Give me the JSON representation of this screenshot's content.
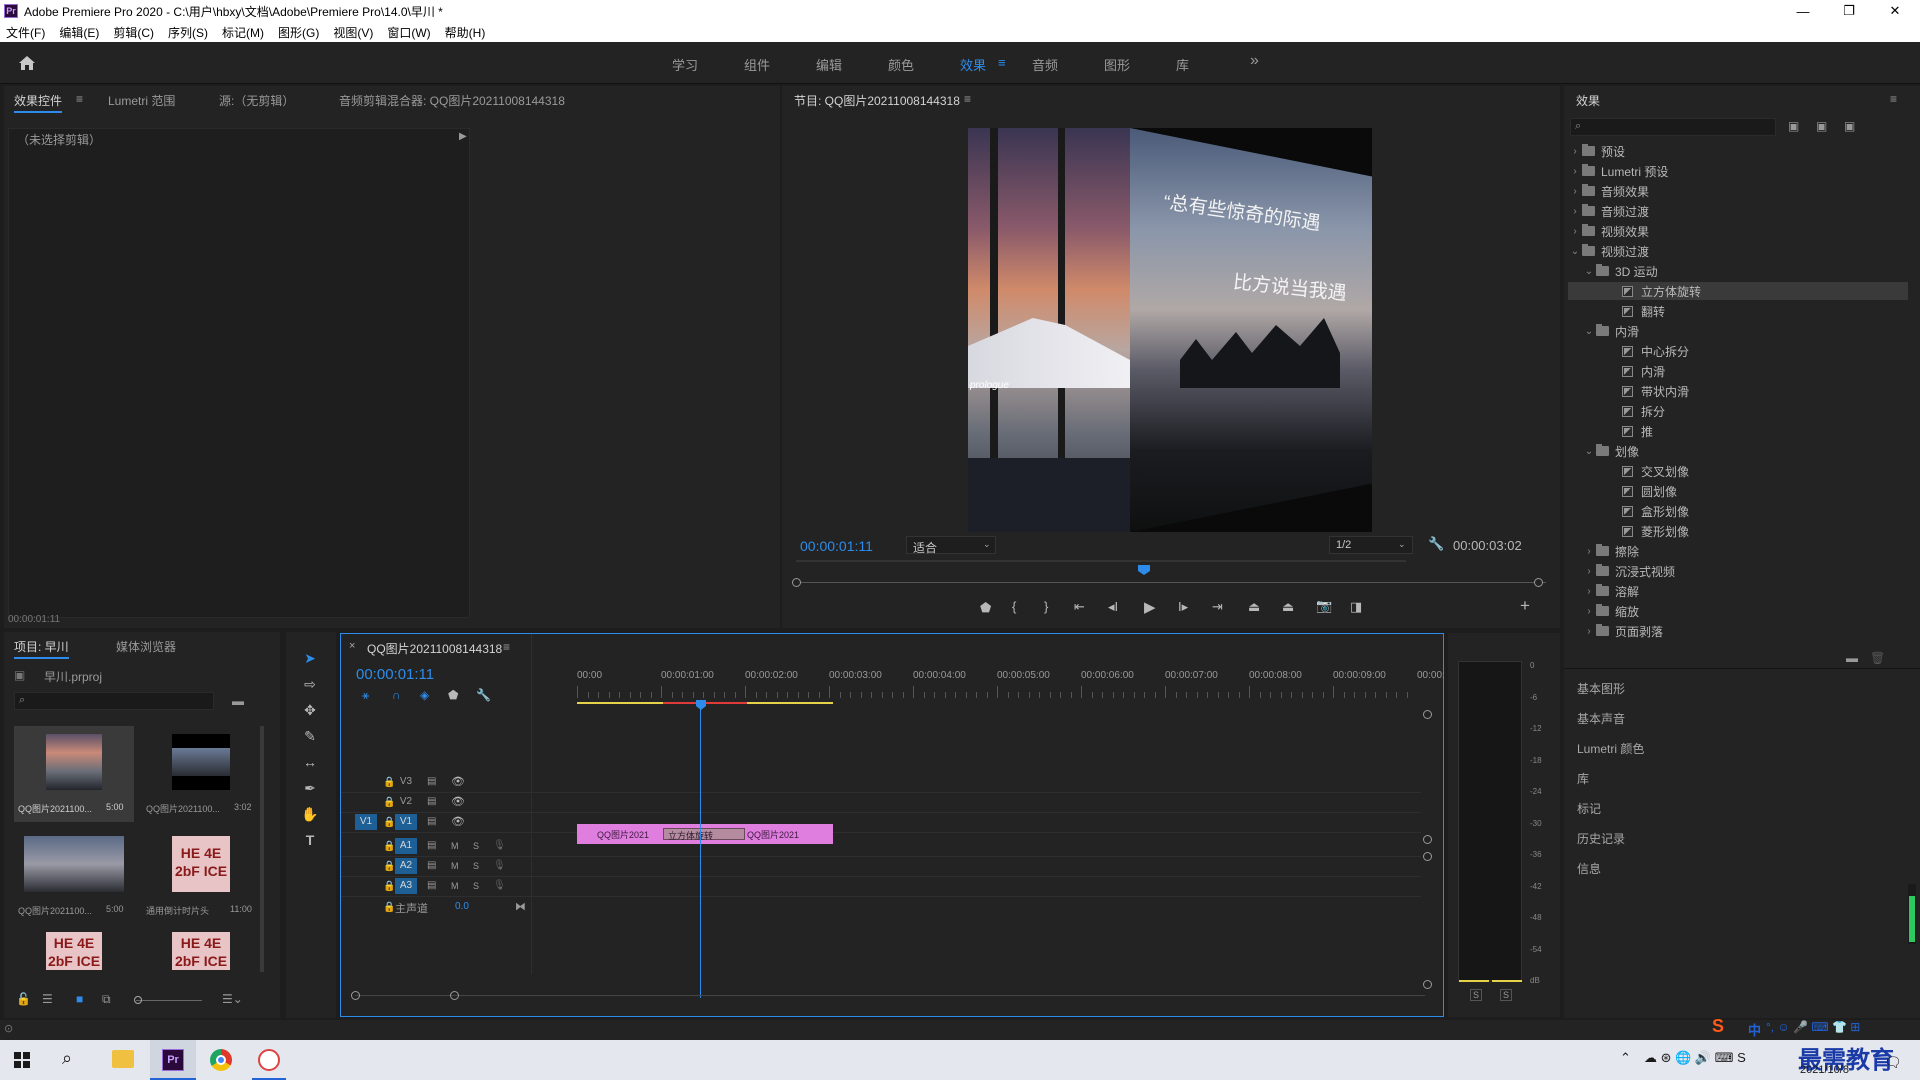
{
  "window": {
    "title": "Adobe Premiere Pro 2020 - C:\\用户\\hbxy\\文档\\Adobe\\Premiere Pro\\14.0\\早川 *",
    "controls": {
      "minimize": "—",
      "maximize": "❐",
      "close": "✕"
    }
  },
  "menu": [
    "文件(F)",
    "编辑(E)",
    "剪辑(C)",
    "序列(S)",
    "标记(M)",
    "图形(G)",
    "视图(V)",
    "窗口(W)",
    "帮助(H)"
  ],
  "workspaces": {
    "items": [
      "学习",
      "组件",
      "编辑",
      "颜色",
      "效果",
      "音频",
      "图形",
      "库"
    ],
    "active": "效果",
    "more": "»"
  },
  "effect_controls": {
    "tabs": [
      "效果控件",
      "Lumetri 范围",
      "源:（无剪辑）",
      "音频剪辑混合器: QQ图片20211008144318"
    ],
    "no_clip": "（未选择剪辑）",
    "timecode": "00:00:01:11"
  },
  "program_monitor": {
    "title": "节目: QQ图片20211008144318",
    "timecode": "00:00:01:11",
    "fit": "适合",
    "resolution": "1/2",
    "duration": "00:00:03:02",
    "overlay_line1": "“总有些惊奇的际遇",
    "overlay_line2": "比方说当我遇",
    "overlay_small": "prologue"
  },
  "effects_panel": {
    "title": "效果",
    "tree": [
      {
        "label": "预设",
        "level": 0,
        "type": "folder",
        "expanded": false
      },
      {
        "label": "Lumetri 预设",
        "level": 0,
        "type": "folder",
        "expanded": false
      },
      {
        "label": "音频效果",
        "level": 0,
        "type": "folder",
        "expanded": false
      },
      {
        "label": "音频过渡",
        "level": 0,
        "type": "folder",
        "expanded": false
      },
      {
        "label": "视频效果",
        "level": 0,
        "type": "folder",
        "expanded": false
      },
      {
        "label": "视频过渡",
        "level": 0,
        "type": "folder",
        "expanded": true
      },
      {
        "label": "3D 运动",
        "level": 1,
        "type": "folder",
        "expanded": true
      },
      {
        "label": "立方体旋转",
        "level": 2,
        "type": "fx",
        "selected": true
      },
      {
        "label": "翻转",
        "level": 2,
        "type": "fx"
      },
      {
        "label": "内滑",
        "level": 1,
        "type": "folder",
        "expanded": true
      },
      {
        "label": "中心拆分",
        "level": 2,
        "type": "fx"
      },
      {
        "label": "内滑",
        "level": 2,
        "type": "fx"
      },
      {
        "label": "带状内滑",
        "level": 2,
        "type": "fx"
      },
      {
        "label": "拆分",
        "level": 2,
        "type": "fx"
      },
      {
        "label": "推",
        "level": 2,
        "type": "fx"
      },
      {
        "label": "划像",
        "level": 1,
        "type": "folder",
        "expanded": true
      },
      {
        "label": "交叉划像",
        "level": 2,
        "type": "fx"
      },
      {
        "label": "圆划像",
        "level": 2,
        "type": "fx"
      },
      {
        "label": "盒形划像",
        "level": 2,
        "type": "fx"
      },
      {
        "label": "菱形划像",
        "level": 2,
        "type": "fx"
      },
      {
        "label": "擦除",
        "level": 1,
        "type": "folder",
        "expanded": false
      },
      {
        "label": "沉浸式视频",
        "level": 1,
        "type": "folder",
        "expanded": false
      },
      {
        "label": "溶解",
        "level": 1,
        "type": "folder",
        "expanded": false
      },
      {
        "label": "缩放",
        "level": 1,
        "type": "folder",
        "expanded": false
      },
      {
        "label": "页面剥落",
        "level": 1,
        "type": "folder",
        "expanded": false
      }
    ],
    "side_panels": [
      "基本图形",
      "基本声音",
      "Lumetri 颜色",
      "库",
      "标记",
      "历史记录",
      "信息"
    ]
  },
  "project": {
    "tabs": [
      "项目: 早川",
      "媒体浏览器"
    ],
    "file": "早川.prproj",
    "items": [
      {
        "name": "QQ图片2021100...",
        "duration": "5:00"
      },
      {
        "name": "QQ图片2021100...",
        "duration": "3:02"
      },
      {
        "name": "QQ图片2021100...",
        "duration": "5:00"
      },
      {
        "name": "通用倒计时片头",
        "duration": "11:00"
      },
      {
        "name": "",
        "duration": ""
      },
      {
        "name": "",
        "duration": ""
      }
    ],
    "countdown_text": "HE 4E\n2bF ICE"
  },
  "timeline": {
    "title": "QQ图片20211008144318",
    "timecode": "00:00:01:11",
    "ruler": [
      "00:00",
      "00:00:01:00",
      "00:00:02:00",
      "00:00:03:00",
      "00:00:04:00",
      "00:00:05:00",
      "00:00:06:00",
      "00:00:07:00",
      "00:00:08:00",
      "00:00:09:00",
      "00:00:"
    ],
    "video_tracks": [
      "V3",
      "V2",
      "V1"
    ],
    "audio_tracks": [
      "A1",
      "A2",
      "A3"
    ],
    "source_patch": "V1",
    "master": {
      "label": "主声道",
      "value": "0.0"
    },
    "clip_a": "QQ图片2021",
    "clip_b": "QQ图片2021",
    "transition": "立方体旋转",
    "mute": "M",
    "solo": "S"
  },
  "meters": {
    "scale": [
      "0",
      "-6",
      "-12",
      "-18",
      "-24",
      "-30",
      "-36",
      "-42",
      "-48",
      "-54",
      "dB"
    ],
    "solo": [
      "S",
      "S"
    ]
  },
  "taskbar": {
    "ime": "中",
    "date": "2021/10/8",
    "watermark": "最需教育",
    "brand": "S"
  },
  "colors": {
    "accent": "#2d8ceb",
    "clip": "#e07ee0",
    "transition": "#b58ba0",
    "track_patch": "#1e5f96"
  }
}
